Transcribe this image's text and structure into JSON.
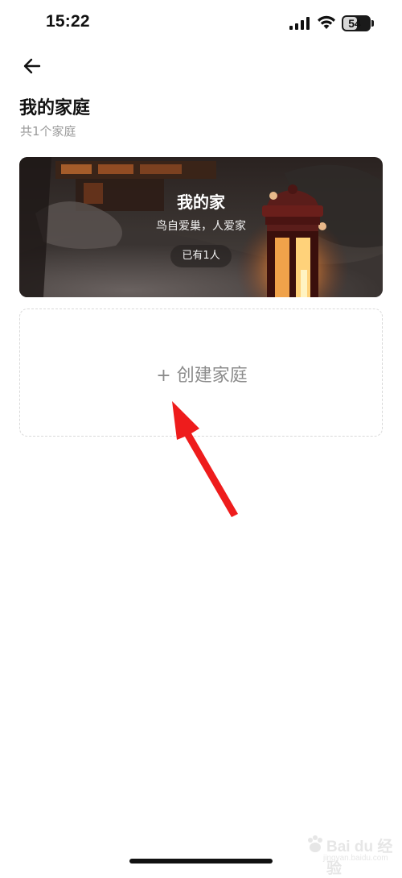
{
  "status_bar": {
    "time": "15:22",
    "battery_level": "54",
    "battery_fraction": 0.54
  },
  "header": {
    "back_icon": "back-arrow-icon",
    "title": "我的家庭",
    "subtitle": "共1个家庭"
  },
  "family_card": {
    "name": "我的家",
    "slogan": "鸟自爱巢，人爱家",
    "members": "已有1人"
  },
  "create_family": {
    "label": "+ 创建家庭"
  },
  "watermark": {
    "brand": "Bai du 经验",
    "url": "jingyan.baidu.com"
  },
  "colors": {
    "annotation_arrow": "#ee1c1c",
    "subtitle_gray": "#9a9a9a",
    "dashed_border": "#d9d9d9"
  }
}
